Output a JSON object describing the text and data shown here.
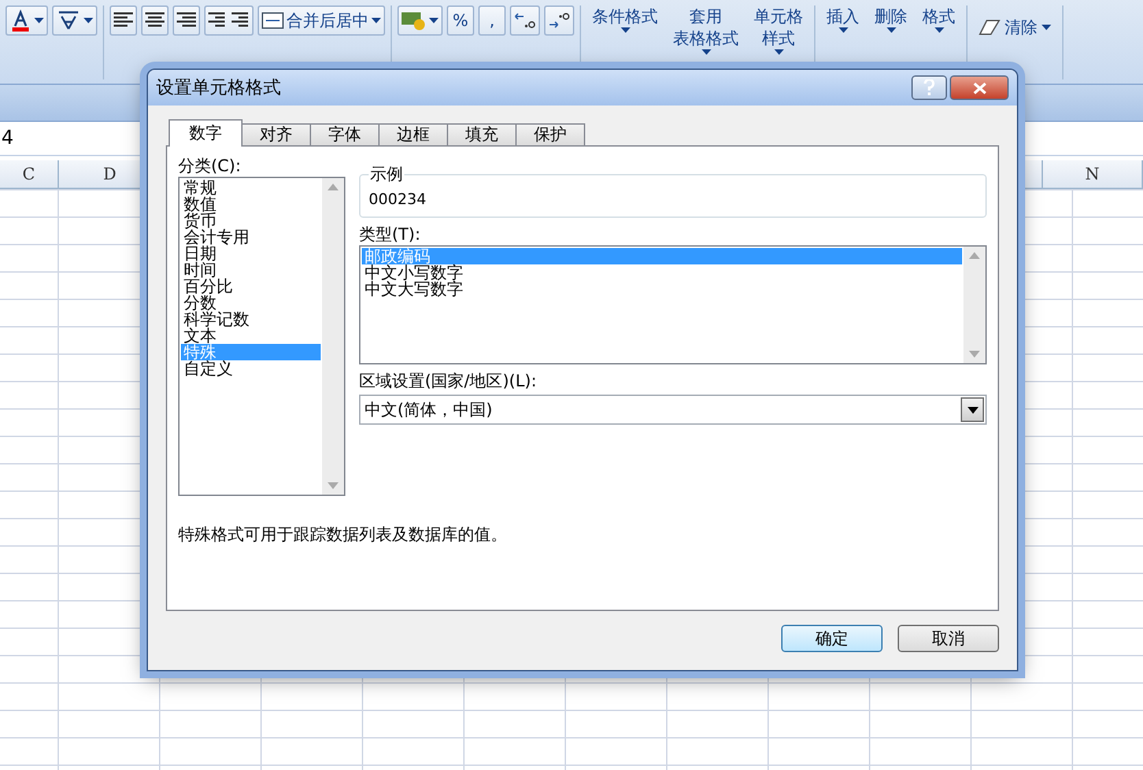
{
  "ribbon": {
    "align_group": {
      "merge_label": "合并后居中"
    },
    "number_group": {
      "percent": "%",
      "comma": ","
    },
    "big_buttons": [
      {
        "lines": [
          "条件格式"
        ]
      },
      {
        "lines": [
          "套用",
          "表格格式"
        ]
      },
      {
        "lines": [
          "单元格",
          "样式"
        ]
      },
      {
        "lines": [
          "插入"
        ]
      },
      {
        "lines": [
          "删除"
        ]
      },
      {
        "lines": [
          "格式"
        ]
      }
    ],
    "clear_label": "清除"
  },
  "formula_bar": {
    "name_box": "4"
  },
  "sheet": {
    "columns": [
      {
        "label": "C"
      },
      {
        "label": "D"
      },
      {
        "label": "N"
      }
    ]
  },
  "dialog": {
    "title": "设置单元格格式",
    "tabs": [
      {
        "label": "数字",
        "selected": true
      },
      {
        "label": "对齐",
        "selected": false
      },
      {
        "label": "字体",
        "selected": false
      },
      {
        "label": "边框",
        "selected": false
      },
      {
        "label": "填充",
        "selected": false
      },
      {
        "label": "保护",
        "selected": false
      }
    ],
    "category_label": "分类(C):",
    "categories": [
      {
        "label": "常规",
        "selected": false
      },
      {
        "label": "数值",
        "selected": false
      },
      {
        "label": "货币",
        "selected": false
      },
      {
        "label": "会计专用",
        "selected": false
      },
      {
        "label": "日期",
        "selected": false
      },
      {
        "label": "时间",
        "selected": false
      },
      {
        "label": "百分比",
        "selected": false
      },
      {
        "label": "分数",
        "selected": false
      },
      {
        "label": "科学记数",
        "selected": false
      },
      {
        "label": "文本",
        "selected": false
      },
      {
        "label": "特殊",
        "selected": true
      },
      {
        "label": "自定义",
        "selected": false
      }
    ],
    "sample": {
      "legend": "示例",
      "value": "000234"
    },
    "type_label": "类型(T):",
    "types": [
      {
        "label": "邮政编码",
        "selected": true
      },
      {
        "label": "中文小写数字",
        "selected": false
      },
      {
        "label": "中文大写数字",
        "selected": false
      }
    ],
    "locale_label": "区域设置(国家/地区)(L):",
    "locale_value": "中文(简体，中国)",
    "description": "特殊格式可用于跟踪数据列表及数据库的值。",
    "buttons": [
      {
        "label": "确定",
        "default": true
      },
      {
        "label": "取消",
        "default": false
      }
    ]
  }
}
